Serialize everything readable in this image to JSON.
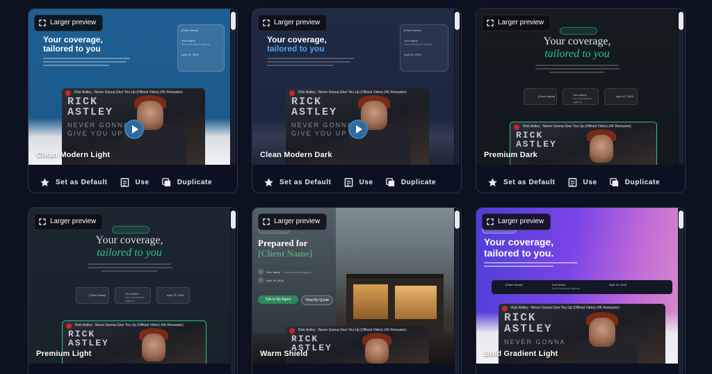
{
  "cards": [
    {
      "larger_preview": "Larger preview",
      "name": "Clean Modern Light",
      "hero_line1": "Your coverage,",
      "hero_line2": "tailored to you",
      "video_title": "Rick Astley - Never Gonna Give You Up (Official Video) (4K Remaster)",
      "video_big1": "RICK",
      "video_big2": "ASTLEY",
      "video_sub1": "NEVER GONNA",
      "video_sub2": "GIVE YOU UP",
      "panel_client": "[Client Name]",
      "panel_agent": "Your Name",
      "panel_agency": "Your Insurance Agency",
      "panel_date": "April 15, 2026",
      "actions": [
        "Set as Default",
        "Use",
        "Duplicate"
      ]
    },
    {
      "larger_preview": "Larger preview",
      "name": "Clean Modern Dark",
      "hero_line1": "Your coverage,",
      "hero_line2": "tailored to you",
      "video_title": "Rick Astley - Never Gonna Give You Up (Official Video) (4K Remaster)",
      "video_big1": "RICK",
      "video_big2": "ASTLEY",
      "video_sub1": "NEVER GONNA",
      "video_sub2": "GIVE YOU UP",
      "panel_client": "[Client Name]",
      "panel_agent": "Your Name",
      "panel_agency": "Your Insurance Agency",
      "panel_date": "April 15, 2026",
      "actions": [
        "Set as Default",
        "Use",
        "Duplicate"
      ]
    },
    {
      "larger_preview": "Larger preview",
      "name": "Premium Dark",
      "hero_line1": "Your coverage,",
      "hero_line2": "tailored to you",
      "video_title": "Rick Astley - Never Gonna Give You Up (Official Video) (4K Remaster)",
      "video_big1": "RICK",
      "video_big2": "ASTLEY",
      "chip1": "[Client Name]",
      "chip2_a": "Your Name",
      "chip2_b": "Your Insurance Agency",
      "chip3": "April 15, 2026",
      "actions": [
        "Set as Default",
        "Use",
        "Duplicate"
      ]
    },
    {
      "larger_preview": "Larger preview",
      "name": "Premium Light",
      "hero_line1": "Your coverage,",
      "hero_line2": "tailored to you",
      "video_title": "Rick Astley - Never Gonna Give You Up (Official Video) (4K Remaster)",
      "video_big1": "RICK",
      "video_big2": "ASTLEY",
      "chip1": "[Client Name]",
      "chip2_a": "Your Name",
      "chip2_b": "Your Insurance Agency",
      "chip3": "April 15, 2026"
    },
    {
      "larger_preview": "Larger preview",
      "name": "Warm Shield",
      "hero_line1": "Prepared for",
      "hero_line2": "[Client Name]",
      "agent_name": "Your Name",
      "agency": "Your Insurance Agency",
      "date": "April 15, 2026",
      "btn_primary": "Talk to My Agent",
      "btn_secondary": "View My Quote",
      "video_title": "Rick Astley - Never Gonna Give You Up (Official Video) (4K Remaster)",
      "video_big1": "RICK",
      "video_big2": "ASTLEY"
    },
    {
      "larger_preview": "Larger preview",
      "name": "Bold Gradient Light",
      "hero_line1": "Your coverage,",
      "hero_line2": "tailored to you.",
      "chip1_b": "[Client Name]",
      "chip2_b": "Your Name",
      "chip2_c": "Your Insurance Agency",
      "chip3_b": "April 15, 2026",
      "video_title": "Rick Astley - Never Gonna Give You Up (Official Video) (4K Remaster)",
      "video_big1": "RICK",
      "video_big2": "ASTLEY",
      "video_sub1": "NEVER GONNA"
    }
  ],
  "icons": {
    "expand": "expand-icon",
    "star": "star-icon",
    "use": "document-icon",
    "duplicate": "copy-icon"
  },
  "colors": {
    "page_bg": "#0d1220",
    "card_border": "#2c3548",
    "accent_blue": "#4aa8e8",
    "accent_green": "#2fc48a",
    "accent_purple": "#8a4cf0"
  }
}
